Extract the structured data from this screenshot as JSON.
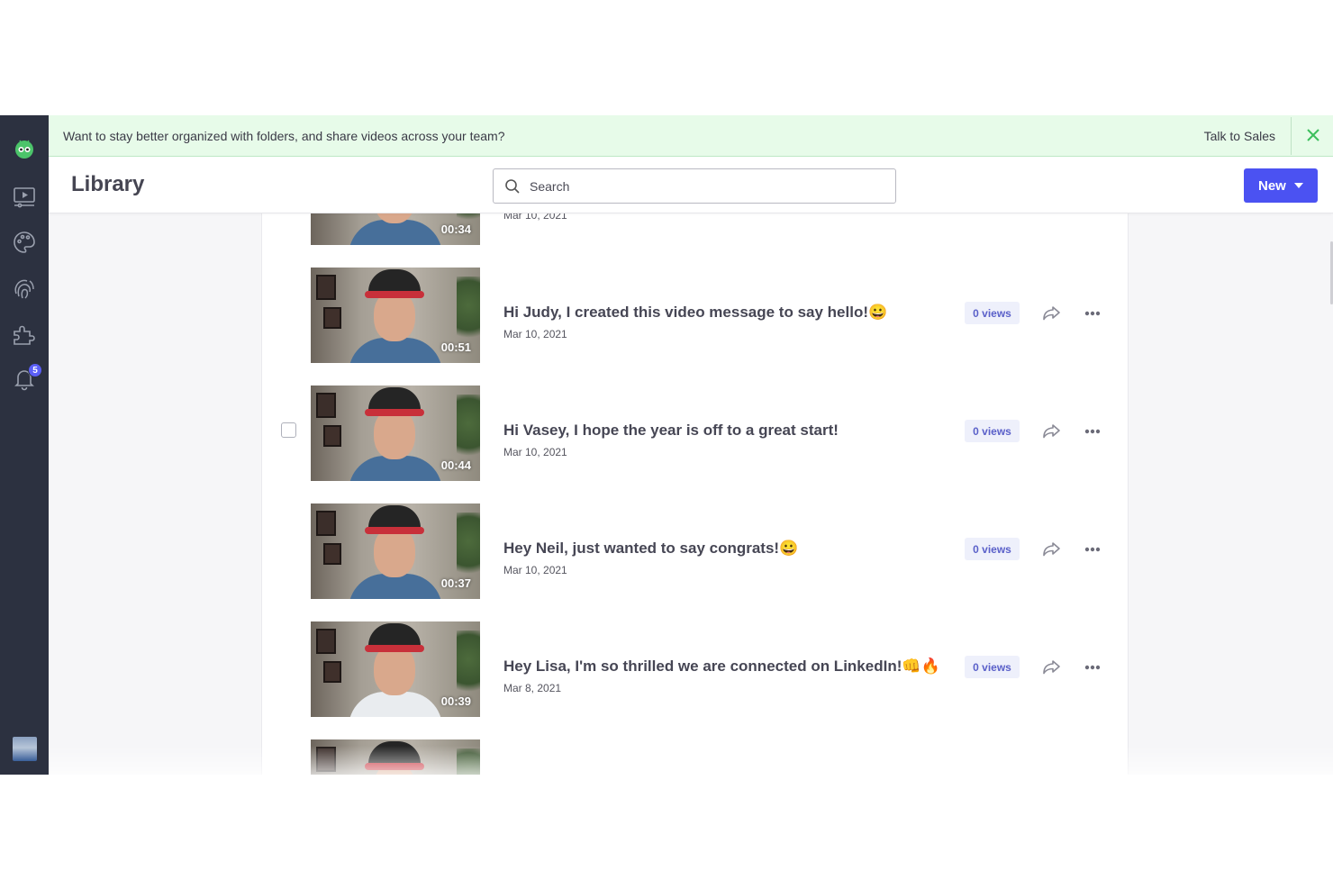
{
  "banner": {
    "message": "Want to stay better organized with folders, and share videos across your team?",
    "cta": "Talk to Sales"
  },
  "header": {
    "title": "Library",
    "search_placeholder": "Search",
    "new_label": "New"
  },
  "sidebar": {
    "items": [
      {
        "name": "logo-icon"
      },
      {
        "name": "videos-icon"
      },
      {
        "name": "palette-icon"
      },
      {
        "name": "fingerprint-icon"
      },
      {
        "name": "integrations-icon"
      },
      {
        "name": "notifications-icon",
        "badge": "5"
      }
    ]
  },
  "videos": [
    {
      "title": "",
      "date": "Mar 10, 2021",
      "duration": "00:34",
      "views": ""
    },
    {
      "title": "Hi Judy, I created this video message to say hello!😀",
      "date": "Mar 10, 2021",
      "duration": "00:51",
      "views": "0 views"
    },
    {
      "title": "Hi Vasey, I hope the year is off to a great start!",
      "date": "Mar 10, 2021",
      "duration": "00:44",
      "views": "0 views"
    },
    {
      "title": "Hey Neil, just wanted to say congrats!😀",
      "date": "Mar 10, 2021",
      "duration": "00:37",
      "views": "0 views"
    },
    {
      "title": "Hey Lisa, I'm so thrilled we are connected on LinkedIn!👊🔥",
      "date": "Mar 8, 2021",
      "duration": "00:39",
      "views": "0 views"
    }
  ],
  "colors": {
    "sidebar": "#2c3140",
    "accent": "#4b52f2",
    "banner_bg": "#e7fbe9",
    "views_bg": "#eef0fb"
  }
}
